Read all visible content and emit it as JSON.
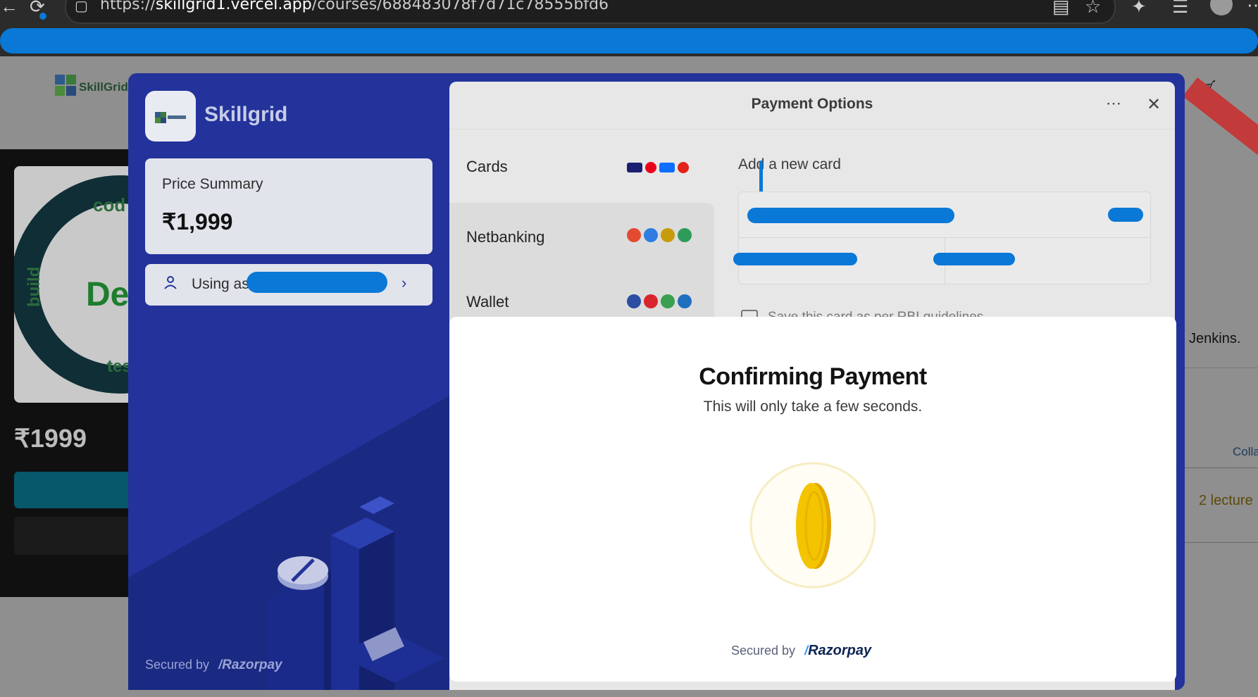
{
  "browser": {
    "url_prefix": "https://",
    "url_domain": "skillgrid1.vercel.app",
    "url_path": "/courses/688483078f7d71c78555bfd6"
  },
  "background_page": {
    "logo_text": "SkillGrid",
    "course_price": "₹1999",
    "right_text_1": "Jenkins.",
    "right_text_2": "Colla",
    "right_text_3": "2 lecture",
    "thumb_words": [
      "cod",
      "build",
      "De",
      "tes"
    ]
  },
  "checkout": {
    "merchant_name": "Skillgrid",
    "price_summary_label": "Price Summary",
    "price_value": "₹1,999",
    "using_as_label": "Using as +",
    "secured_by": "Secured by",
    "brand": "Razorpay",
    "panel_title": "Payment Options",
    "methods": [
      {
        "label": "Cards",
        "logos": [
          "#1a1f71",
          "#eb001b",
          "#0d6efd",
          "#e2231a"
        ]
      },
      {
        "label": "Netbanking",
        "logos": [
          "#e34b31",
          "#2f7de1",
          "#c79b0b",
          "#2f9b5a"
        ]
      },
      {
        "label": "Wallet",
        "logos": [
          "#2b4ea3",
          "#d9262c",
          "#3aa04f",
          "#1f6fbf"
        ]
      }
    ],
    "add_card_title": "Add a new card",
    "save_card_label": "Save this card as per RBI guidelines"
  },
  "confirm": {
    "title": "Confirming Payment",
    "subtitle": "This will only take a few seconds.",
    "secured_by": "Secured by",
    "brand": "Razorpay"
  },
  "colors": {
    "modal_blue": "#23339b",
    "redaction": "#0a78d7",
    "coin": "#f5c400"
  }
}
